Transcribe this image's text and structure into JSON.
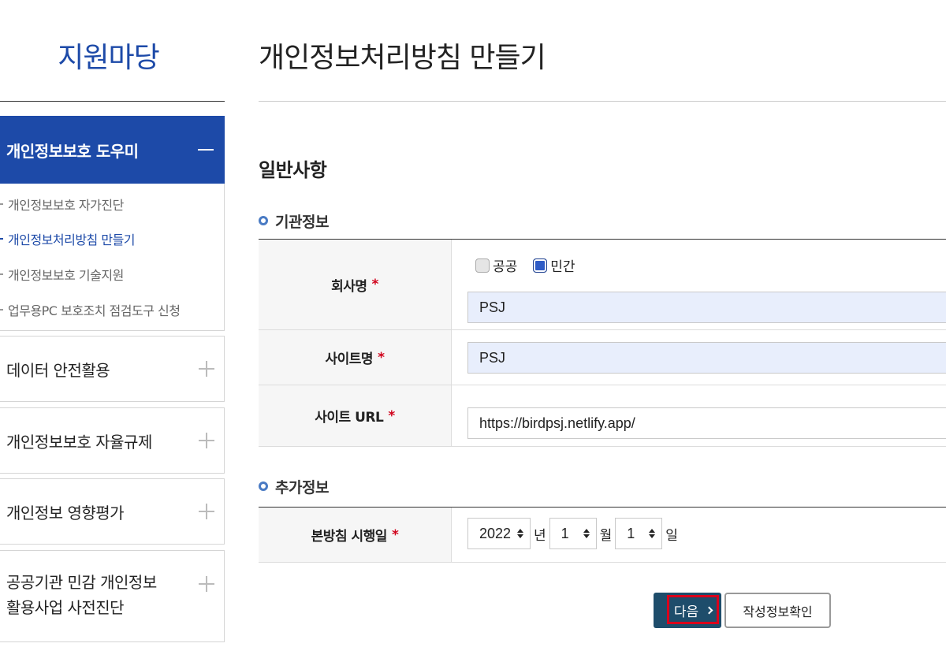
{
  "sidebar": {
    "title": "지원마당",
    "active_menu": "개인정보보호 도우미",
    "submenu": [
      {
        "label": "개인정보보호 자가진단",
        "active": false
      },
      {
        "label": "개인정보처리방침 만들기",
        "active": true
      },
      {
        "label": "개인정보보호 기술지원",
        "active": false
      },
      {
        "label": "업무용PC 보호조치 점검도구 신청",
        "active": false
      }
    ],
    "menus": [
      {
        "label": "데이터 안전활용"
      },
      {
        "label": "개인정보보호 자율규제"
      },
      {
        "label": "개인정보 영향평가"
      },
      {
        "label_line1": "공공기관 민감 개인정보",
        "label_line2": "활용사업 사전진단"
      }
    ]
  },
  "main": {
    "page_title": "개인정보처리방침 만들기",
    "section_title": "일반사항",
    "org_info": {
      "title": "기관정보",
      "company_label": "회사명",
      "required_mark": "*",
      "type_options": [
        {
          "label": "공공",
          "checked": false
        },
        {
          "label": "민간",
          "checked": true
        }
      ],
      "company_value": "PSJ",
      "site_name_label": "사이트명",
      "site_name_value": "PSJ",
      "site_url_label": "사이트 URL",
      "site_url_value": "https://birdpsj.netlify.app/"
    },
    "extra_info": {
      "title": "추가정보",
      "date_label": "본방침 시행일",
      "year": "2022",
      "year_unit": "년",
      "month": "1",
      "month_unit": "월",
      "day": "1",
      "day_unit": "일"
    },
    "buttons": {
      "next_label": "다음",
      "check_label": "작성정보확인"
    }
  },
  "colors": {
    "brand_blue": "#1d4aa8",
    "button_dark": "#1e4d6b",
    "required_red": "#d0021b",
    "input_highlight": "#e8eefc",
    "focus_red": "#d9001b"
  }
}
